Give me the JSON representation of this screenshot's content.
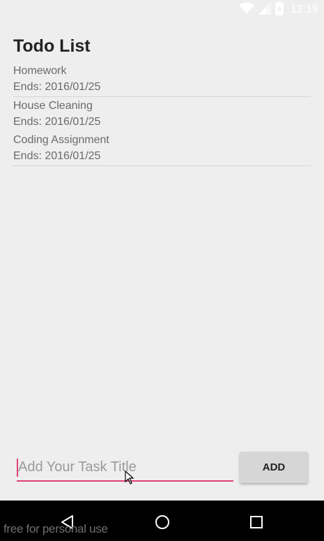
{
  "status_bar": {
    "time": "12:19",
    "icons": [
      "wifi-icon",
      "signal-icon",
      "battery-icon"
    ]
  },
  "header": {
    "title": "Todo List"
  },
  "tasks": [
    {
      "title": "Homework",
      "due": "Ends: 2016/01/25"
    },
    {
      "title": "House Cleaning",
      "due": "Ends: 2016/01/25"
    },
    {
      "title": "Coding Assignment",
      "due": "Ends: 2016/01/25"
    }
  ],
  "input": {
    "placeholder": "Add Your Task Title",
    "value": ""
  },
  "add_button": {
    "label": "ADD"
  },
  "navigation": {
    "buttons": [
      "back-icon",
      "home-icon",
      "recents-icon"
    ]
  },
  "watermark": "free for personal use",
  "colors": {
    "accent": "#e0407a",
    "background": "#eeeeee",
    "button": "#d6d6d6"
  }
}
